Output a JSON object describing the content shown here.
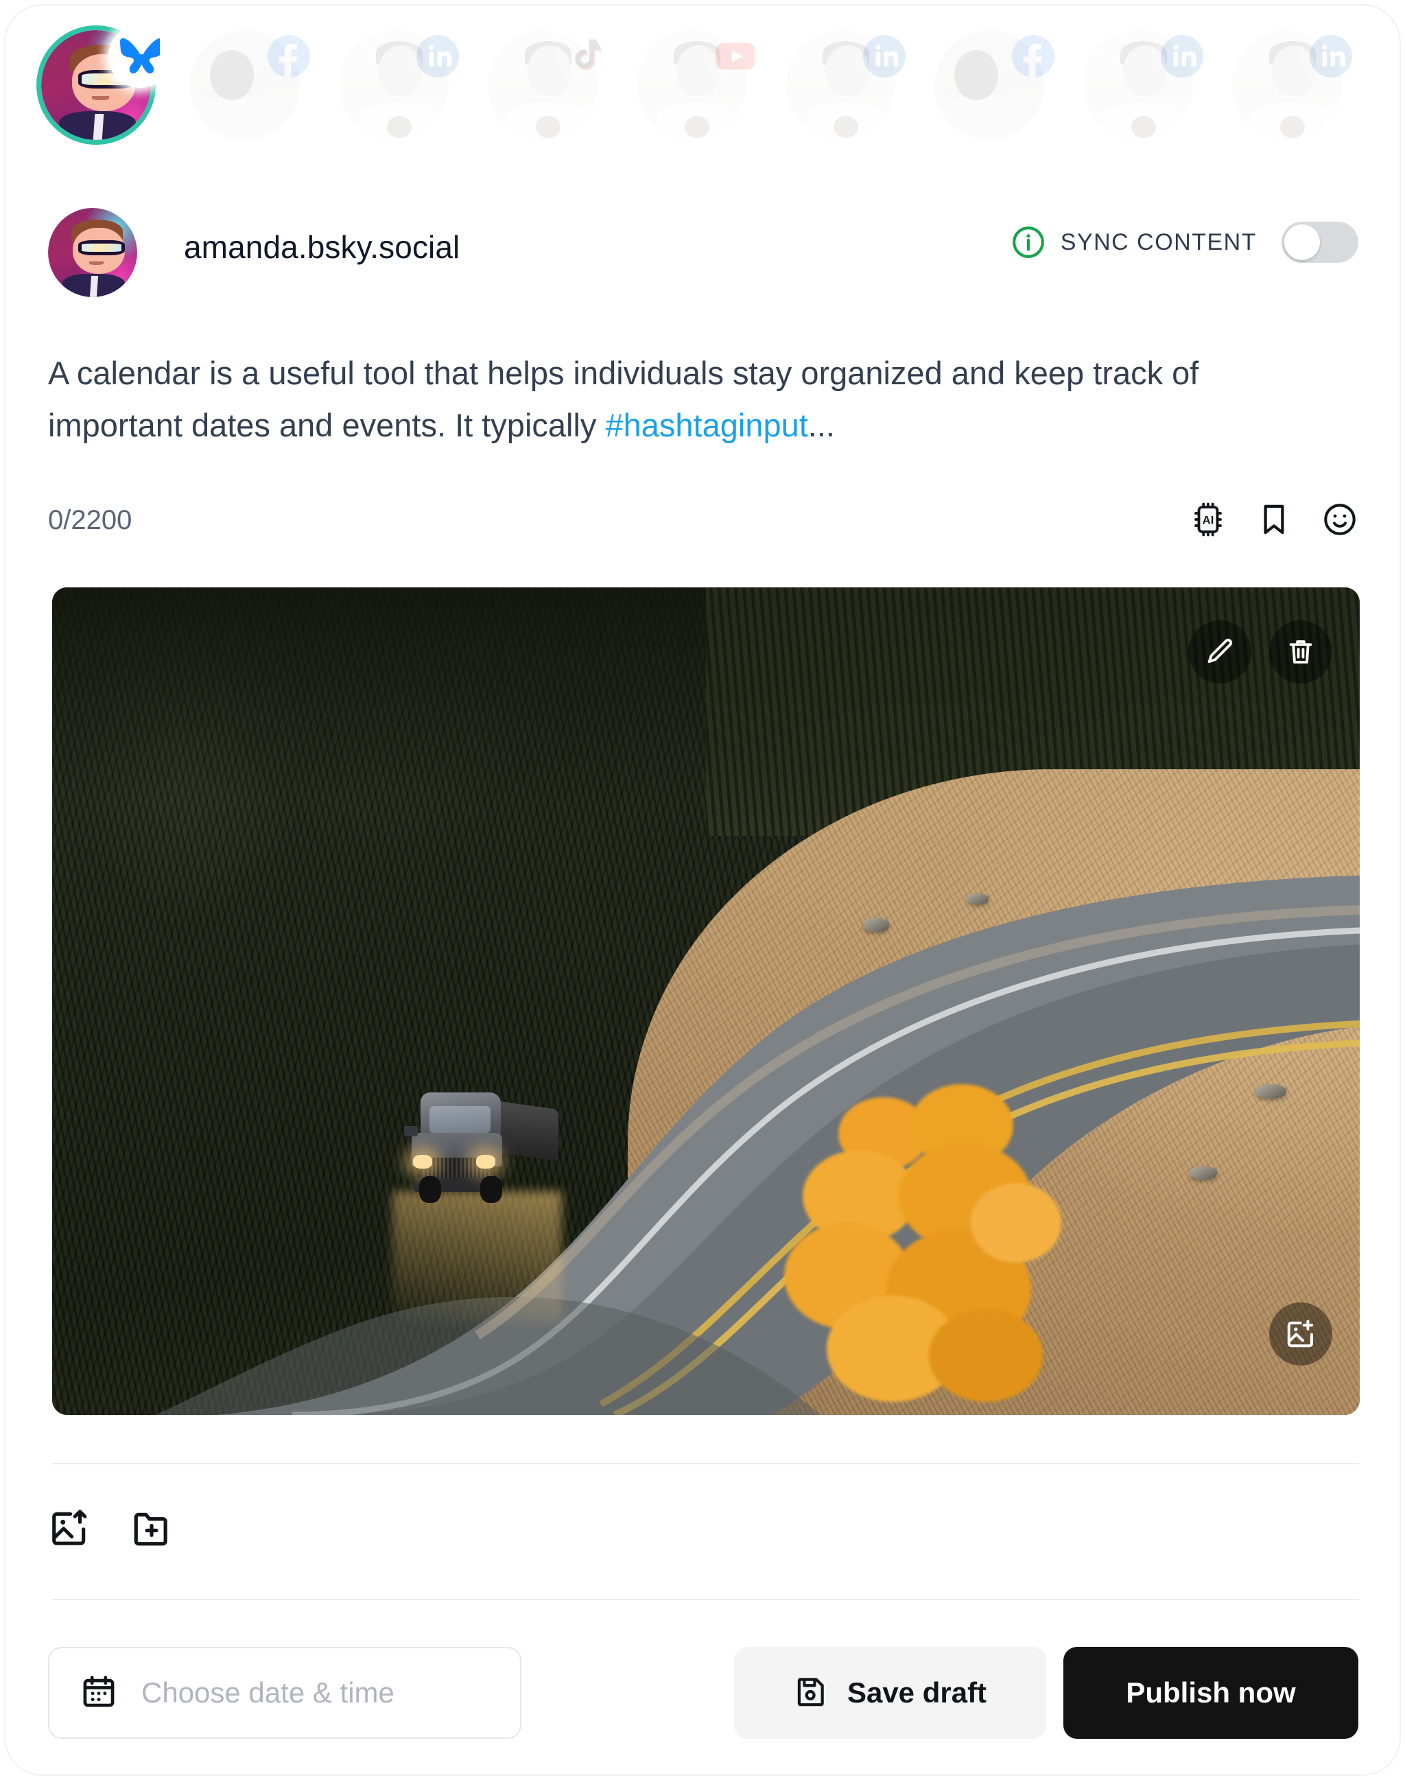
{
  "accounts_strip": [
    {
      "platform": "bluesky",
      "icon": "butterfly-icon",
      "active": true
    },
    {
      "platform": "facebook",
      "icon": "facebook-icon",
      "active": false
    },
    {
      "platform": "linkedin",
      "icon": "linkedin-icon",
      "active": false
    },
    {
      "platform": "tiktok",
      "icon": "tiktok-icon",
      "active": false
    },
    {
      "platform": "youtube",
      "icon": "youtube-icon",
      "active": false
    },
    {
      "platform": "linkedin",
      "icon": "linkedin-icon",
      "active": false
    },
    {
      "platform": "facebook",
      "icon": "facebook-icon",
      "active": false
    },
    {
      "platform": "linkedin",
      "icon": "linkedin-icon",
      "active": false
    },
    {
      "platform": "linkedin",
      "icon": "linkedin-icon",
      "active": false
    }
  ],
  "account": {
    "handle": "amanda.bsky.social",
    "avatar_alt": "cartoon-man-with-glasses"
  },
  "sync": {
    "label": "SYNC CONTENT",
    "info_icon": "info-circle-icon",
    "info_color": "#22a martins",
    "toggle_on": false
  },
  "composer": {
    "text_before": "A calendar is a useful tool that helps individuals stay organized and keep track of important dates and events. It typically ",
    "hashtag": "#hashtaginput",
    "text_after": "...",
    "char_counter": "0/2200",
    "hashtag_color": "#1aa0e8"
  },
  "composer_icons": [
    {
      "name": "ai-chip-icon",
      "label": "AI"
    },
    {
      "name": "bookmark-icon",
      "label": "Bookmark"
    },
    {
      "name": "emoji-icon",
      "label": "Emoji"
    }
  ],
  "media": {
    "alt": "winding mountain road with pickup truck in autumn forest",
    "buttons": [
      {
        "name": "edit-media-button",
        "icon": "pencil-icon"
      },
      {
        "name": "delete-media-button",
        "icon": "trash-icon"
      },
      {
        "name": "add-media-button",
        "icon": "image-plus-icon"
      }
    ]
  },
  "toolbar": [
    {
      "name": "upload-image-button",
      "icon": "image-upload-icon"
    },
    {
      "name": "add-folder-button",
      "icon": "folder-plus-icon"
    }
  ],
  "footer": {
    "date_placeholder": "Choose date & time",
    "date_icon": "calendar-icon",
    "save_draft_label": "Save draft",
    "save_draft_icon": "floppy-disk-icon",
    "publish_label": "Publish now",
    "publish_bg": "#131313"
  }
}
